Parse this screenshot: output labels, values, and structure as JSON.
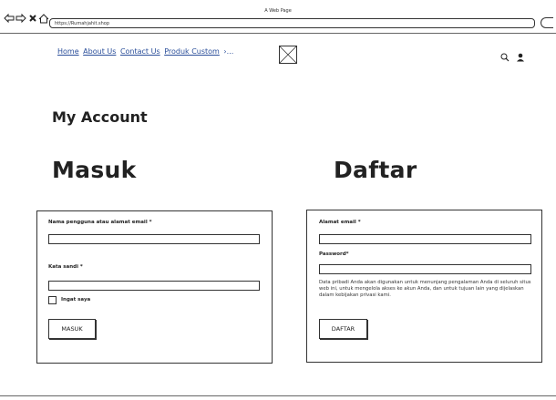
{
  "browser": {
    "title": "A Web Page",
    "url": "https://Rumahjahit.shop"
  },
  "header": {
    "nav_links": [
      "Home",
      "About Us",
      "Contact Us",
      "Produk Custom",
      "›..."
    ],
    "search_icon": "search-icon",
    "user_icon": "user-icon"
  },
  "page": {
    "title": "My Account"
  },
  "login": {
    "heading": "Masuk",
    "username_label": "Nama pengguna atau alamat email *",
    "password_label": "Kata sandi *",
    "remember_label": "Ingat saya",
    "submit_label": "MASUK"
  },
  "register": {
    "heading": "Daftar",
    "email_label": "Alamat email *",
    "password_label": "Password*",
    "privacy_text": "Data pribadi Anda akan digunakan untuk menunjang pengalaman Anda di seluruh situs web ini, untuk mengelola akses ke akun Anda, dan untuk tujuan lain yang dijelaskan dalam kebijakan privasi kami.",
    "submit_label": "DAFTAR"
  }
}
